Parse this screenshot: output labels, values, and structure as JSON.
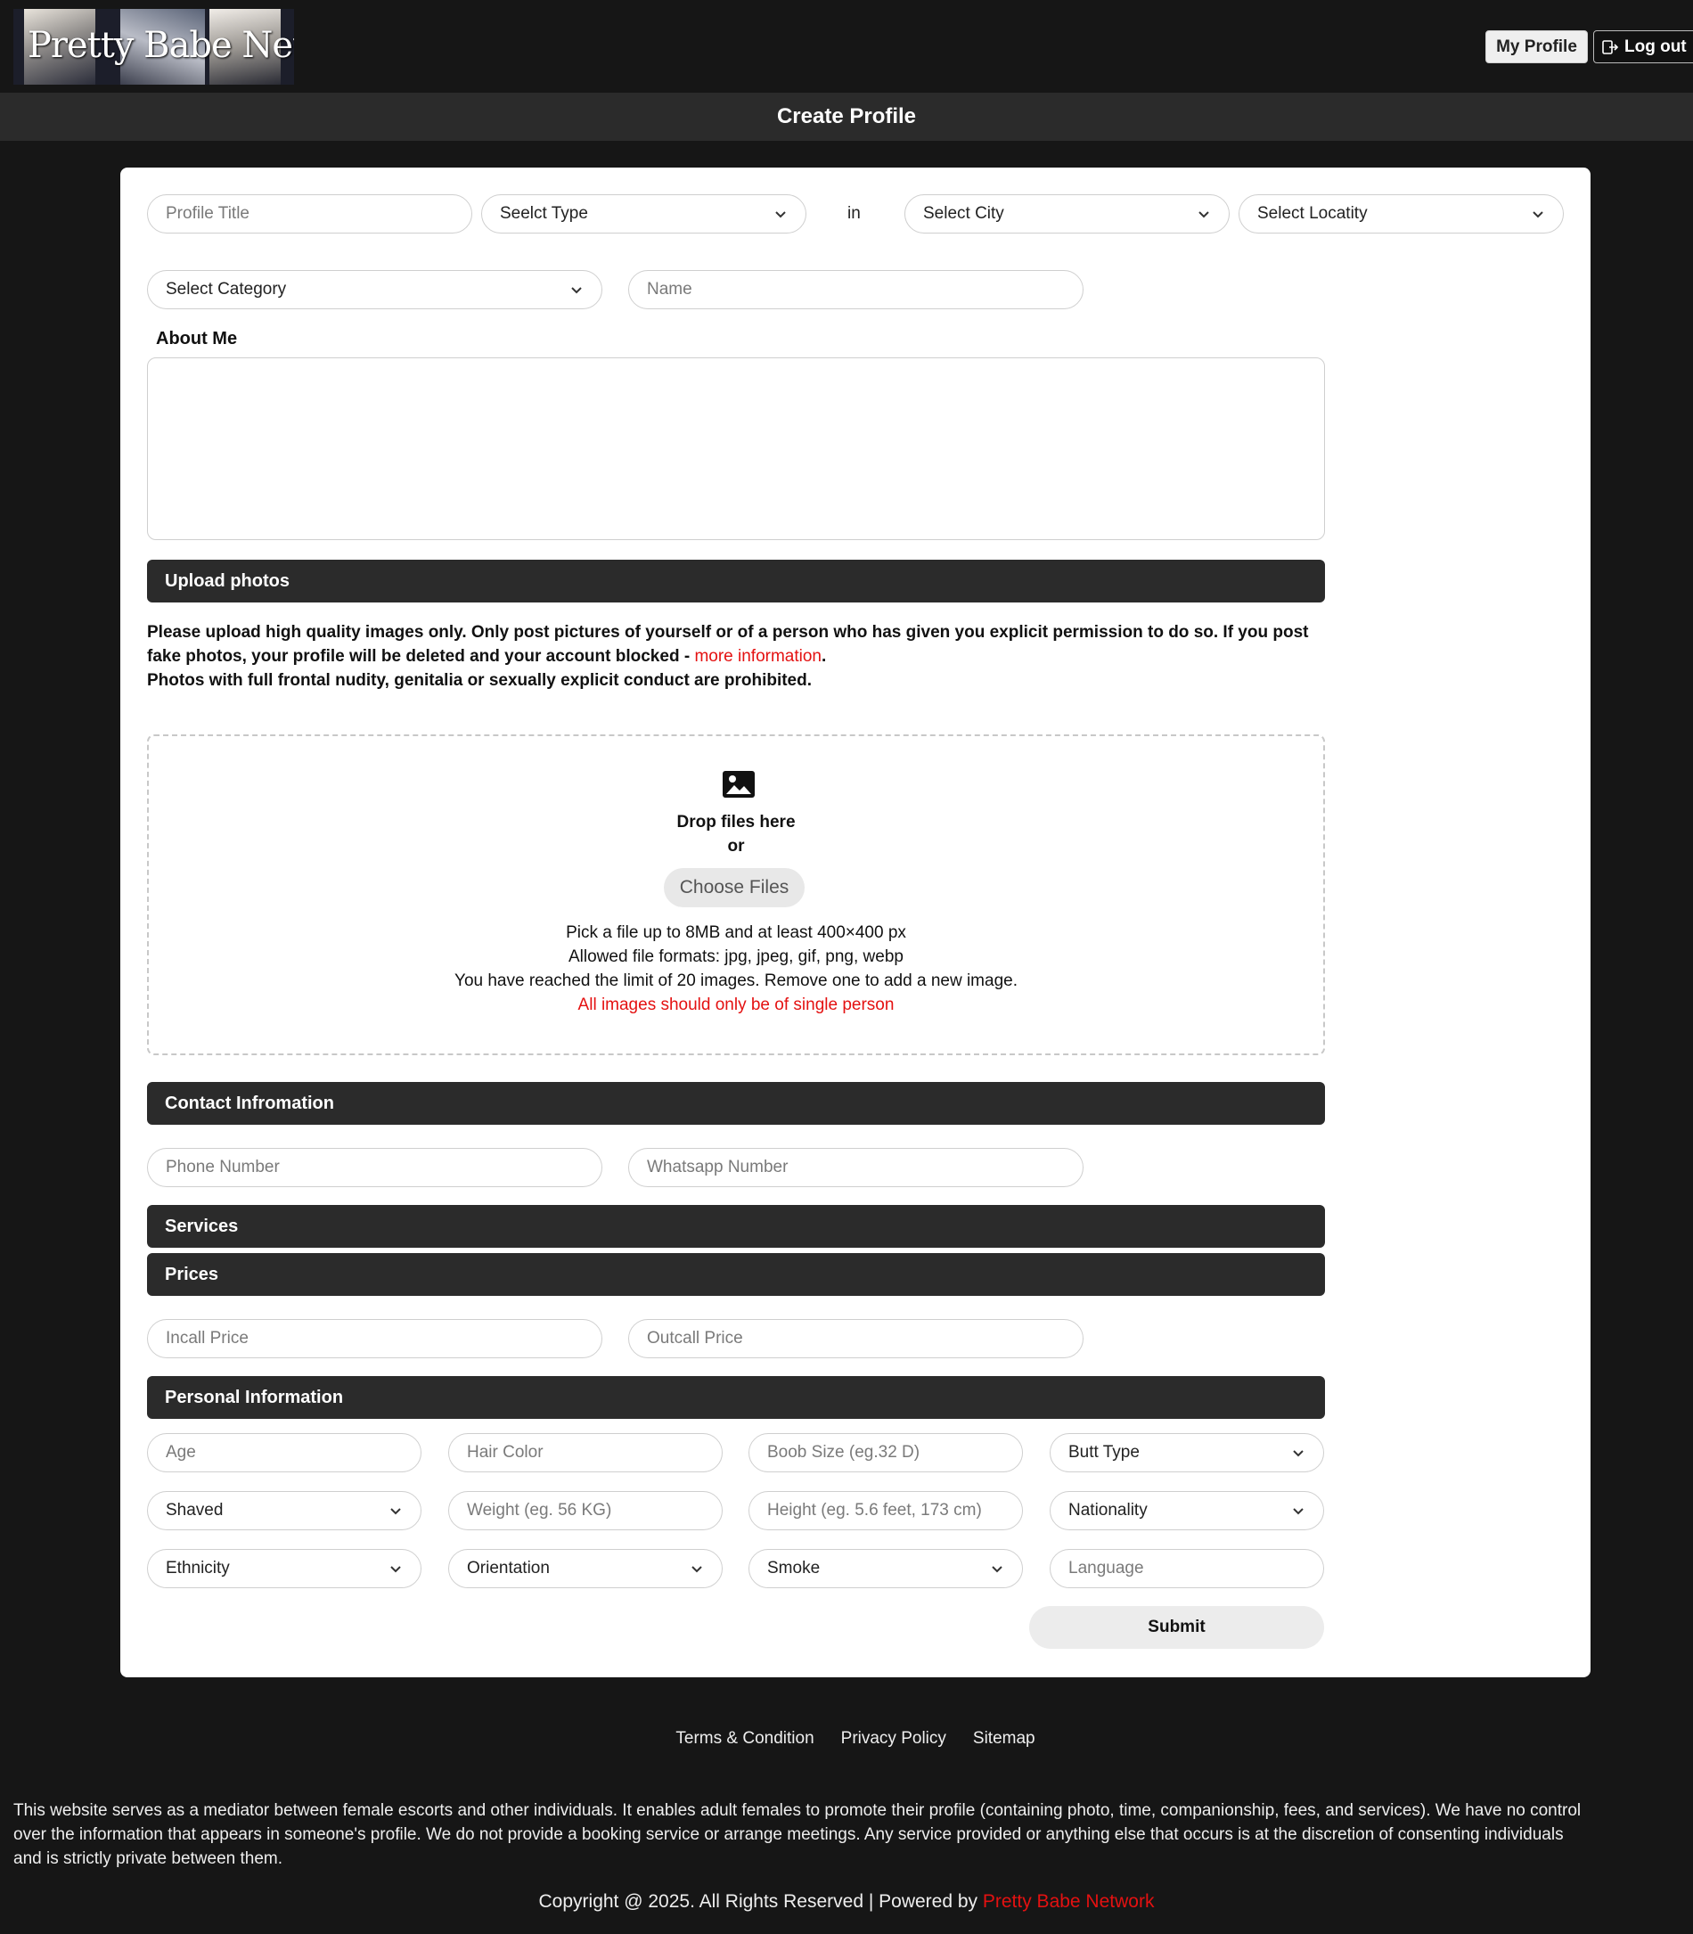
{
  "header": {
    "logo_text": "Pretty Babe Network",
    "my_profile_label": "My Profile",
    "logout_label": "Log out"
  },
  "page_title": "Create Profile",
  "form": {
    "profile_title_placeholder": "Profile Title",
    "type_select": "Seelct Type",
    "in_label": "in",
    "city_select": "Select City",
    "locality_select": "Select Locatity",
    "category_select": "Select Category",
    "name_placeholder": "Name",
    "about_label": "About Me"
  },
  "upload": {
    "section_title": "Upload photos",
    "notice_line1": "Please upload high quality images only. Only post pictures of yourself or of a person who has given you explicit permission to do so. If you post fake photos, your profile will be deleted and your account blocked - ",
    "more_info_link": "more information",
    "notice_period": ".",
    "notice_line2": "Photos with full frontal nudity, genitalia or sexually explicit conduct are prohibited.",
    "drop_text": "Drop files here",
    "or_text": "or",
    "choose_files": "Choose Files",
    "rule1": "Pick a file up to 8MB and at least 400×400 px",
    "rule2": "Allowed file formats: jpg, jpeg, gif, png, webp",
    "rule3": "You have reached the limit of 20 images. Remove one to add a new image.",
    "rule_red": "All images should only be of single person"
  },
  "contact": {
    "section_title": "Contact Infromation",
    "phone_placeholder": "Phone Number",
    "whatsapp_placeholder": "Whatsapp Number"
  },
  "services": {
    "section_title": "Services"
  },
  "prices": {
    "section_title": "Prices",
    "incall_placeholder": "Incall Price",
    "outcall_placeholder": "Outcall Price"
  },
  "personal": {
    "section_title": "Personal Information",
    "age_placeholder": "Age",
    "hair_placeholder": "Hair Color",
    "boob_placeholder": "Boob Size (eg.32 D)",
    "butt_select": "Butt Type",
    "shaved_select": "Shaved",
    "weight_placeholder": "Weight (eg. 56 KG)",
    "height_placeholder": "Height (eg. 5.6 feet, 173 cm)",
    "nationality_select": "Nationality",
    "ethnicity_select": "Ethnicity",
    "orientation_select": "Orientation",
    "smoke_select": "Smoke",
    "language_placeholder": "Language"
  },
  "submit_label": "Submit",
  "footer": {
    "links": [
      "Terms & Condition",
      "Privacy Policy",
      "Sitemap"
    ],
    "disclaimer": "This website serves as a mediator between female escorts and other individuals. It enables adult females to promote their profile (containing photo, time, companionship, fees, and services). We have no control\nover the information that appears in someone's profile. We do not provide a booking service or arrange meetings. Any service provided or anything else that occurs is at the discretion of consenting individuals\nand is strictly private between them.",
    "copyright_prefix": "Copyright @ 2025. All Rights Reserved | Powered by ",
    "brand": "Pretty Babe Network"
  },
  "colors": {
    "accent_red": "#e41111",
    "bar_dark": "#2b2b2b",
    "background": "#161616"
  }
}
